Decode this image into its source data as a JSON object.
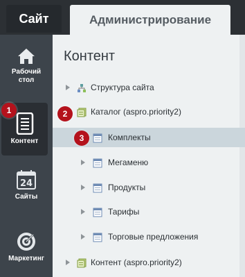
{
  "tabs": {
    "site": "Сайт",
    "admin": "Администрирование"
  },
  "sidebar": {
    "items": [
      {
        "label": "Рабочий стол",
        "icon": "home-icon"
      },
      {
        "label": "Контент",
        "icon": "document-icon"
      },
      {
        "label": "Сайты",
        "icon": "calendar-icon",
        "icon_text": "24"
      },
      {
        "label": "Маркетинг",
        "icon": "target-icon"
      }
    ]
  },
  "main": {
    "title": "Контент",
    "tree": [
      {
        "label": "Структура сайта",
        "icon": "structure-icon"
      },
      {
        "label": "Каталог (aspro.priority2)",
        "icon": "catalog-icon",
        "expanded": true
      },
      {
        "label": "Комплекты",
        "icon": "iblock-icon",
        "selected": true
      },
      {
        "label": "Мегаменю",
        "icon": "iblock-icon"
      },
      {
        "label": "Продукты",
        "icon": "iblock-icon"
      },
      {
        "label": "Тарифы",
        "icon": "iblock-icon"
      },
      {
        "label": "Торговые предложения",
        "icon": "iblock-icon"
      },
      {
        "label": "Контент (aspro.priority2)",
        "icon": "catalog-icon"
      }
    ]
  },
  "badges": [
    "1",
    "2",
    "3"
  ],
  "colors": {
    "badge": "#b4121c",
    "sidebar": "#3d444b",
    "selected_row": "#cbd6dc"
  }
}
